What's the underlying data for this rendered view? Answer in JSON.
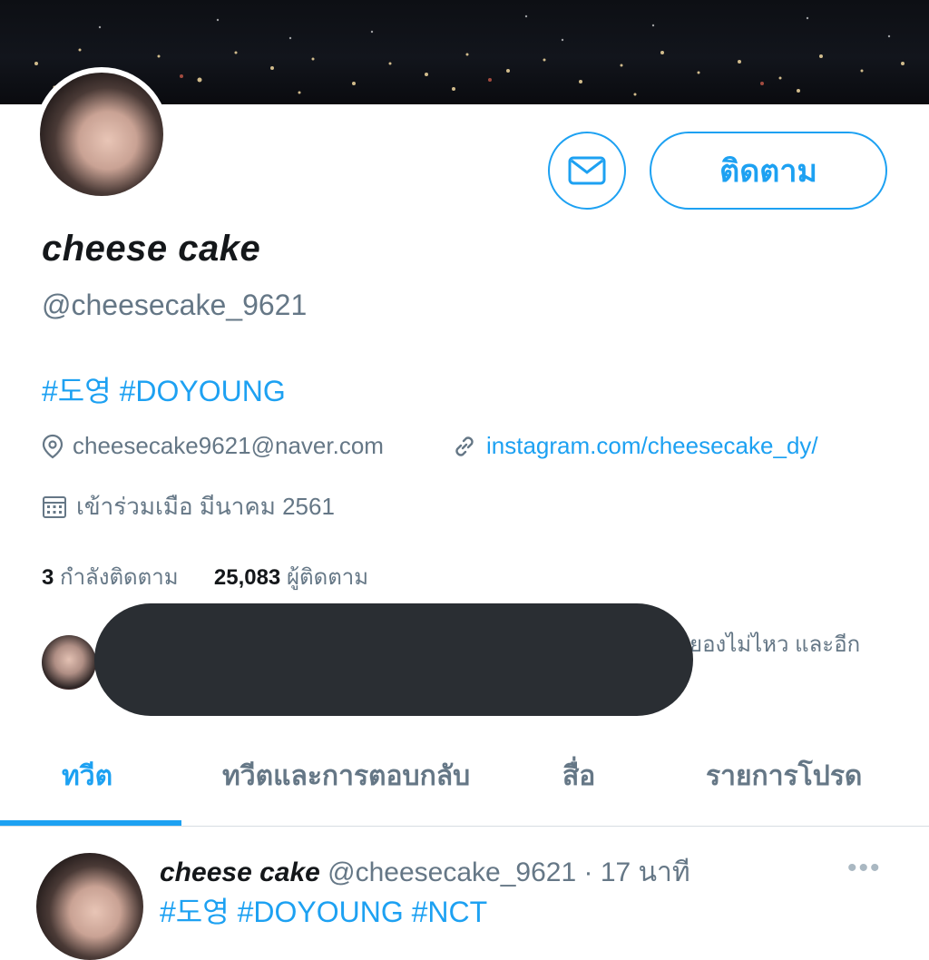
{
  "profile": {
    "follow_label": "ติดตาม",
    "display_name": "cheese cake",
    "handle": "@cheesecake_9621",
    "bio": "#도영 #DOYOUNG",
    "location": "cheesecake9621@naver.com",
    "website": "instagram.com/cheesecake_dy/",
    "joined": "เข้าร่วมเมือ มีนาคม 2561",
    "following_count": "3",
    "following_label": "กำลังติดตาม",
    "followers_count": "25,083",
    "followers_label": "ผู้ติดตาม",
    "followed_by_text": "ยองไม่ไหว และอีก"
  },
  "tabs": [
    {
      "label": "ทวีต",
      "active": true
    },
    {
      "label": "ทวีตและการตอบกลับ",
      "active": false
    },
    {
      "label": "สื่อ",
      "active": false
    },
    {
      "label": "รายการโปรด",
      "active": false
    }
  ],
  "tweet": {
    "name": "cheese cake",
    "handle": "@cheesecake_9621",
    "time": " · 17 นาที",
    "body": "#도영 #DOYOUNG #NCT",
    "more": "•••"
  },
  "colors": {
    "accent": "#1da1f2",
    "secondary_text": "#657786"
  },
  "icons": [
    "mail-icon",
    "location-pin-icon",
    "link-icon",
    "calendar-icon",
    "more-dots-icon"
  ]
}
